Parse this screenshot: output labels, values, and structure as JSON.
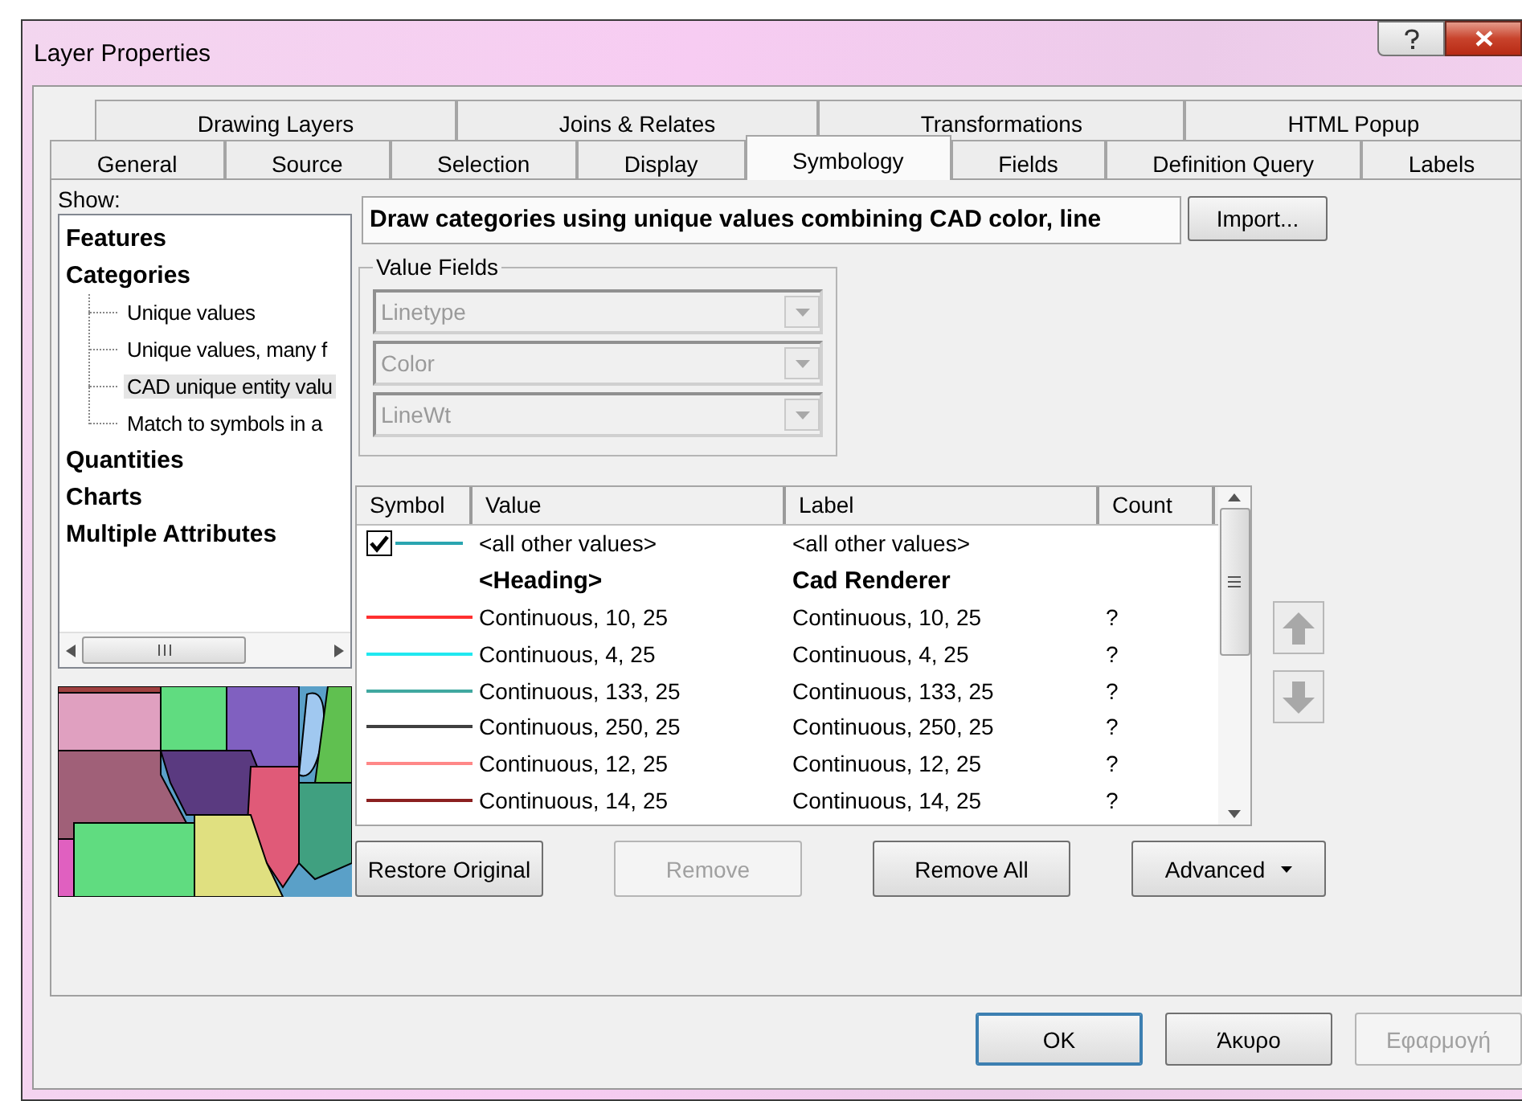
{
  "window": {
    "title": "Layer Properties"
  },
  "tabs": [
    [
      {
        "label": "Drawing Layers",
        "selected": false
      },
      {
        "label": "Joins & Relates",
        "selected": false
      },
      {
        "label": "Transformations",
        "selected": false
      },
      {
        "label": "HTML Popup",
        "selected": false
      }
    ],
    [
      {
        "label": "General",
        "selected": false
      },
      {
        "label": "Source",
        "selected": false
      },
      {
        "label": "Selection",
        "selected": false
      },
      {
        "label": "Display",
        "selected": false
      },
      {
        "label": "Symbology",
        "selected": true
      },
      {
        "label": "Fields",
        "selected": false
      },
      {
        "label": "Definition Query",
        "selected": false
      },
      {
        "label": "Labels",
        "selected": false
      }
    ]
  ],
  "show": {
    "label": "Show:",
    "tree": [
      {
        "label": "Features",
        "selected": false
      },
      {
        "label": "Categories",
        "selected": false,
        "children": [
          {
            "label": "Unique values",
            "selected": false
          },
          {
            "label": "Unique values, many f",
            "selected": false
          },
          {
            "label": "CAD unique entity valu",
            "selected": true
          },
          {
            "label": "Match to symbols in a",
            "selected": false
          }
        ]
      },
      {
        "label": "Quantities",
        "selected": false
      },
      {
        "label": "Charts",
        "selected": false
      },
      {
        "label": "Multiple Attributes",
        "selected": false
      }
    ]
  },
  "description": "Draw categories using unique values combining CAD color, line",
  "import_button": "Import...",
  "value_fields": {
    "label": "Value Fields",
    "fields": [
      {
        "value": "Linetype",
        "disabled": true
      },
      {
        "value": "Color",
        "disabled": true
      },
      {
        "value": "LineWt",
        "disabled": true
      }
    ]
  },
  "table": {
    "columns": [
      "Symbol",
      "Value",
      "Label",
      "Count"
    ],
    "rows": [
      {
        "kind": "check",
        "checked": true,
        "color": "#2aa5b0",
        "value": "<all other values>",
        "label": "<all other values>"
      },
      {
        "kind": "heading",
        "value": "<Heading>",
        "label": "Cad Renderer"
      },
      {
        "kind": "line",
        "color": "#ff3030",
        "value": "Continuous, 10, 25",
        "label": "Continuous, 10, 25",
        "count": "?"
      },
      {
        "kind": "line",
        "color": "#20e8f0",
        "value": "Continuous, 4, 25",
        "label": "Continuous, 4, 25",
        "count": "?"
      },
      {
        "kind": "line",
        "color": "#40a8a0",
        "value": "Continuous, 133, 25",
        "label": "Continuous, 133, 25",
        "count": "?"
      },
      {
        "kind": "line",
        "color": "#404040",
        "value": "Continuous, 250, 25",
        "label": "Continuous, 250, 25",
        "count": "?"
      },
      {
        "kind": "line",
        "color": "#ff8888",
        "value": "Continuous, 12, 25",
        "label": "Continuous, 12, 25",
        "count": "?"
      },
      {
        "kind": "line",
        "color": "#8b2020",
        "value": "Continuous, 14, 25",
        "label": "Continuous, 14, 25",
        "count": "?"
      }
    ]
  },
  "table_buttons": [
    {
      "label": "Restore Original",
      "disabled": false
    },
    {
      "label": "Remove",
      "disabled": true
    },
    {
      "label": "Remove All",
      "disabled": false
    },
    {
      "label": "Advanced",
      "disabled": false,
      "menu": true
    }
  ],
  "dialog_buttons": [
    {
      "label": "OK",
      "disabled": false,
      "default": true
    },
    {
      "label": "Άκυρο",
      "disabled": false,
      "default": false
    },
    {
      "label": "Εφαρμογή",
      "disabled": true,
      "default": false
    }
  ]
}
